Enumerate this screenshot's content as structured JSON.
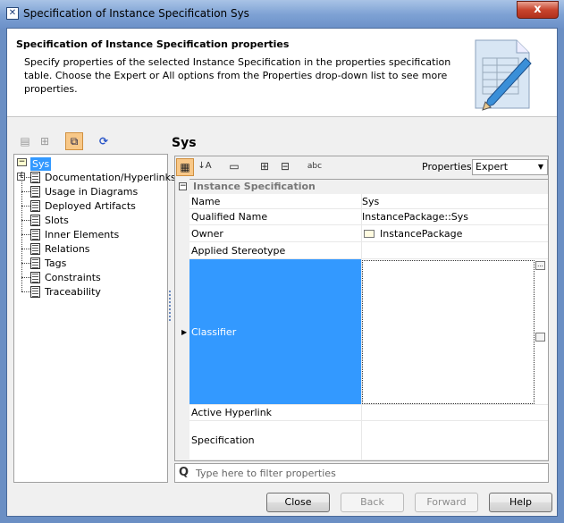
{
  "window": {
    "title": "Specification of Instance Specification Sys",
    "close_label": "x"
  },
  "header": {
    "title": "Specification of Instance Specification properties",
    "description": "Specify properties of the selected Instance Specification in the properties specification table. Choose the Expert or All options from the Properties drop-down list to see more properties."
  },
  "tree": {
    "root": "Sys",
    "items": [
      "Documentation/Hyperlinks",
      "Usage in Diagrams",
      "Deployed Artifacts",
      "Slots",
      "Inner Elements",
      "Relations",
      "Tags",
      "Constraints",
      "Traceability"
    ]
  },
  "right": {
    "title": "Sys",
    "properties_label": "Properties:",
    "properties_value": "Expert"
  },
  "table": {
    "group": "Instance Specification",
    "rows": [
      {
        "key": "Name",
        "value": "Sys"
      },
      {
        "key": "Qualified Name",
        "value": "InstancePackage::Sys"
      },
      {
        "key": "Owner",
        "value": "InstancePackage",
        "icon": "folder-icon"
      },
      {
        "key": "Applied Stereotype",
        "value": ""
      },
      {
        "key": "Classifier",
        "value": "",
        "selected": true
      },
      {
        "key": "Active Hyperlink",
        "value": ""
      },
      {
        "key": "Specification",
        "value": ""
      }
    ]
  },
  "filter": {
    "placeholder": "Type here to filter properties"
  },
  "buttons": {
    "close": "Close",
    "back": "Back",
    "forward": "Forward",
    "help": "Help"
  },
  "colors": {
    "selection": "#3399ff",
    "title_bar": "#7ea2d4"
  }
}
